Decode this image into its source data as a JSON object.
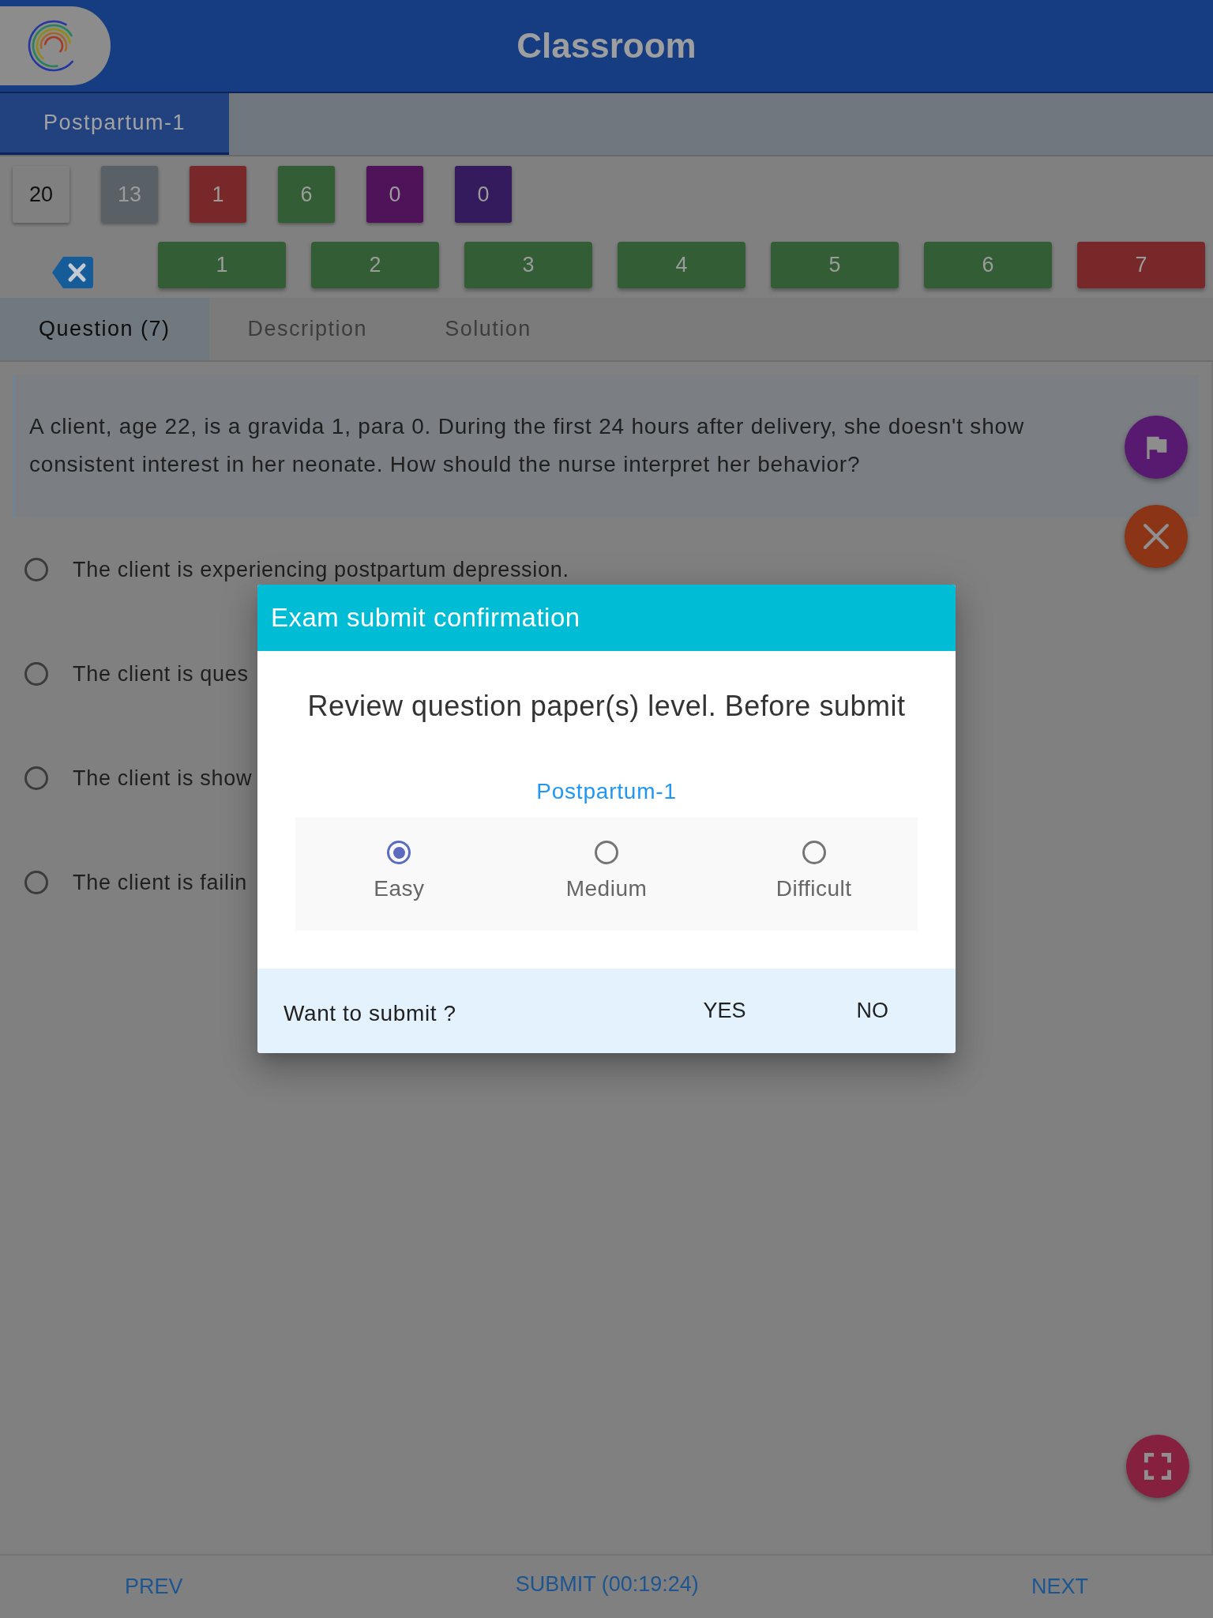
{
  "app_bar": {
    "title": "Classroom"
  },
  "subject_tabs": [
    {
      "label": "Postpartum-1",
      "selected": true
    }
  ],
  "counters": [
    {
      "value": "20",
      "color": "#808080"
    },
    {
      "value": "13",
      "color": "#5a6166"
    },
    {
      "value": "1",
      "color": "#782828"
    },
    {
      "value": "6",
      "color": "#335e35"
    },
    {
      "value": "0",
      "color": "#4e1358"
    },
    {
      "value": "0",
      "color": "#331b5d"
    }
  ],
  "question_nav": [
    {
      "label": "1",
      "color": "#335e35"
    },
    {
      "label": "2",
      "color": "#335e35"
    },
    {
      "label": "3",
      "color": "#335e35"
    },
    {
      "label": "4",
      "color": "#335e35"
    },
    {
      "label": "5",
      "color": "#335e35"
    },
    {
      "label": "6",
      "color": "#335e35"
    },
    {
      "label": "7",
      "color": "#782828"
    }
  ],
  "content_tabs": [
    {
      "label": "Question (7)",
      "selected": true
    },
    {
      "label": "Description",
      "selected": false
    },
    {
      "label": "Solution",
      "selected": false
    }
  ],
  "question": {
    "text": "A client, age 22, is a gravida 1, para 0. During the first 24 hours after delivery, she doesn't show consistent interest in her neonate. How should the nurse interpret her behavior?"
  },
  "options": [
    {
      "text": "The client is experiencing postpartum depression.",
      "selected": false
    },
    {
      "text": "The client is ques",
      "selected": false
    },
    {
      "text": "The client is show",
      "selected": false
    },
    {
      "text": "The client is failin",
      "selected": false
    }
  ],
  "dialog": {
    "title": "Exam submit confirmation",
    "message": "Review question paper(s) level. Before submit",
    "paper": "Postpartum-1",
    "levels": [
      {
        "label": "Easy",
        "selected": true
      },
      {
        "label": "Medium",
        "selected": false
      },
      {
        "label": "Difficult",
        "selected": false
      }
    ],
    "prompt": "Want to submit ?",
    "actions": [
      "YES",
      "NO"
    ]
  },
  "bottom_bar": {
    "prev": "PREV",
    "submit": "SUBMIT (00:19:24)",
    "next": "NEXT"
  }
}
